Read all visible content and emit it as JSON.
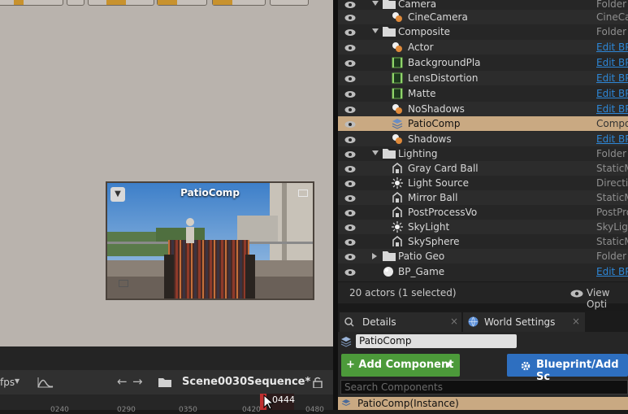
{
  "viewport": {
    "camera_preview_title": "PatioComp"
  },
  "sequencer": {
    "fps_label": "fps",
    "sequence_name": "Scene0030Sequence*",
    "current_frame": "0444",
    "ticks": [
      "0240",
      "0290",
      "0350",
      "0420",
      "0480"
    ]
  },
  "outliner": {
    "rows": [
      {
        "label": "Camera",
        "type": "Folder",
        "kind": "folder",
        "indent": 1,
        "tri": "open"
      },
      {
        "label": "CineCamera",
        "type": "CineCa",
        "kind": "actor",
        "indent": 2
      },
      {
        "label": "Composite",
        "type": "Folder",
        "kind": "folder",
        "indent": 1,
        "tri": "open"
      },
      {
        "label": "Actor",
        "type": "Edit BP",
        "kind": "actor",
        "indent": 2,
        "link": true
      },
      {
        "label": "BackgroundPla",
        "type": "Edit BP",
        "kind": "plate",
        "indent": 2,
        "link": true
      },
      {
        "label": "LensDistortion",
        "type": "Edit BP",
        "kind": "plate",
        "indent": 2,
        "link": true
      },
      {
        "label": "Matte",
        "type": "Edit BP",
        "kind": "plate",
        "indent": 2,
        "link": true
      },
      {
        "label": "NoShadows",
        "type": "Edit BP",
        "kind": "actor",
        "indent": 2,
        "link": true
      },
      {
        "label": "PatioComp",
        "type": "Compo",
        "kind": "layers",
        "indent": 2,
        "selected": true
      },
      {
        "label": "Shadows",
        "type": "Edit BP",
        "kind": "actor",
        "indent": 2,
        "link": true
      },
      {
        "label": "Lighting",
        "type": "Folder",
        "kind": "folder",
        "indent": 1,
        "tri": "open"
      },
      {
        "label": "Gray Card Ball",
        "type": "StaticM",
        "kind": "mesh",
        "indent": 2
      },
      {
        "label": "Light Source",
        "type": "Directio",
        "kind": "light",
        "indent": 2
      },
      {
        "label": "Mirror Ball",
        "type": "StaticM",
        "kind": "mesh",
        "indent": 2
      },
      {
        "label": "PostProcessVo",
        "type": "PostPro",
        "kind": "mesh",
        "indent": 2
      },
      {
        "label": "SkyLight",
        "type": "SkyLigh",
        "kind": "light",
        "indent": 2
      },
      {
        "label": "SkySphere",
        "type": "StaticM",
        "kind": "mesh",
        "indent": 2
      },
      {
        "label": "Patio Geo",
        "type": "Folder",
        "kind": "folder",
        "indent": 1,
        "tri": "closed"
      },
      {
        "label": "BP_Game",
        "type": "Edit BP",
        "kind": "sphere",
        "indent": 1,
        "link": true
      }
    ],
    "status_text": "20 actors (1 selected)",
    "view_options_label": "View Opti"
  },
  "details": {
    "tab_details": "Details",
    "tab_world_settings": "World Settings",
    "actor_name": "PatioComp",
    "add_component_label": "+ Add Component",
    "blueprint_label": "Blueprint/Add Sc",
    "search_placeholder": "Search Components",
    "instance_label": "PatioComp(Instance)"
  },
  "colors": {
    "selection": "#c9a982",
    "accent_orange": "#c8922e",
    "link_blue": "#2d86d6",
    "green_button": "#4c9a3a",
    "blue_button": "#2e6fc0"
  }
}
